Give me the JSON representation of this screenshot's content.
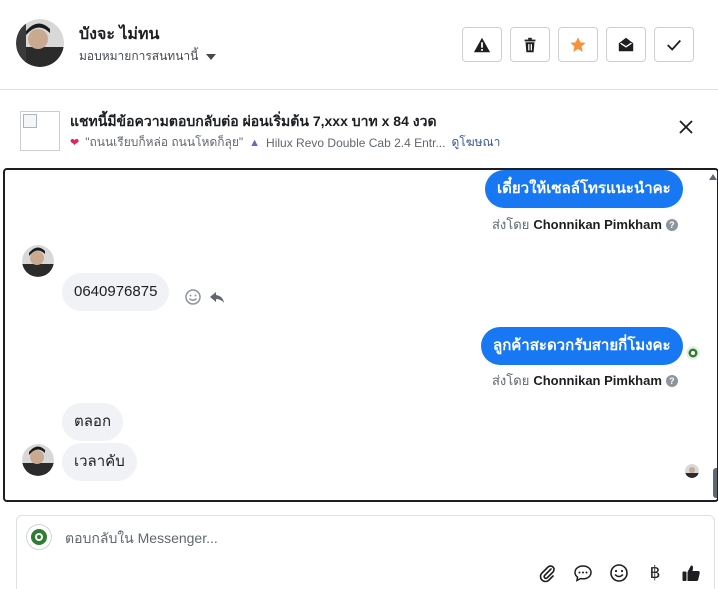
{
  "header": {
    "contact_name": "บังจะ ไม่ทน",
    "assign_label": "มอบหมายการสนทนานี้",
    "actions": [
      {
        "name": "report-button",
        "icon": "warning-icon"
      },
      {
        "name": "delete-button",
        "icon": "trash-icon"
      },
      {
        "name": "star-button",
        "icon": "star-icon"
      },
      {
        "name": "mark-unread-button",
        "icon": "envelope-open-icon"
      },
      {
        "name": "mark-done-button",
        "icon": "check-icon"
      }
    ]
  },
  "ad": {
    "title": "แชทนี้มีข้อความตอบกลับต่อ ผ่อนเริ่มต้น 7,xxx บาท x 84 งวด",
    "snippet": "\"ถนนเรียบก็หล่อ ถนนโหดก็ลุย\"",
    "product": "Hilux Revo Double Cab 2.4 Entr...",
    "view_ad_link": "ดูโฆษณา"
  },
  "messages": {
    "m1_text": "เดี๋ยวให้เซลล์โทรแนะนำคะ",
    "m1_sent_prefix": "ส่งโดย",
    "m1_sender": "Chonnikan Pimkham",
    "m2_text": "0640976875",
    "m3_text": "ลูกค้าสะดวกรับสายกี่โมงคะ",
    "m3_sent_prefix": "ส่งโดย",
    "m3_sender": "Chonnikan Pimkham",
    "m4_text": "ตลอก",
    "m5_text": "เวลาคับ"
  },
  "composer": {
    "placeholder": "ตอบกลับใน Messenger...",
    "tools": [
      "paperclip-icon",
      "speech-bubble-icon",
      "emoji-icon",
      "baht-icon",
      "thumbs-up-icon"
    ],
    "baht_symbol": "฿"
  },
  "colors": {
    "accent": "#1877f2",
    "star": "#f7923b",
    "incoming_bubble": "#f0f2f5"
  }
}
